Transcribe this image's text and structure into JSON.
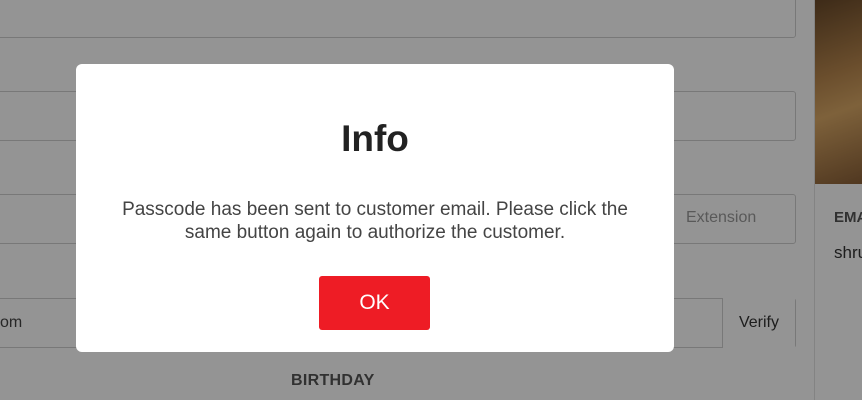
{
  "form": {
    "extension_placeholder": "Extension",
    "email_value_fragment": "om",
    "verify_label": "Verify",
    "birthday_label": "BIRTHDAY"
  },
  "side_panel": {
    "label_fragment": "EMA",
    "value_fragment": "shru"
  },
  "dialog": {
    "title": "Info",
    "message": "Passcode has been sent to customer email. Please click the same button again to authorize the customer.",
    "ok_label": "OK"
  },
  "colors": {
    "ok_button": "#ee1c25",
    "overlay": "rgba(0,0,0,0.42)"
  }
}
